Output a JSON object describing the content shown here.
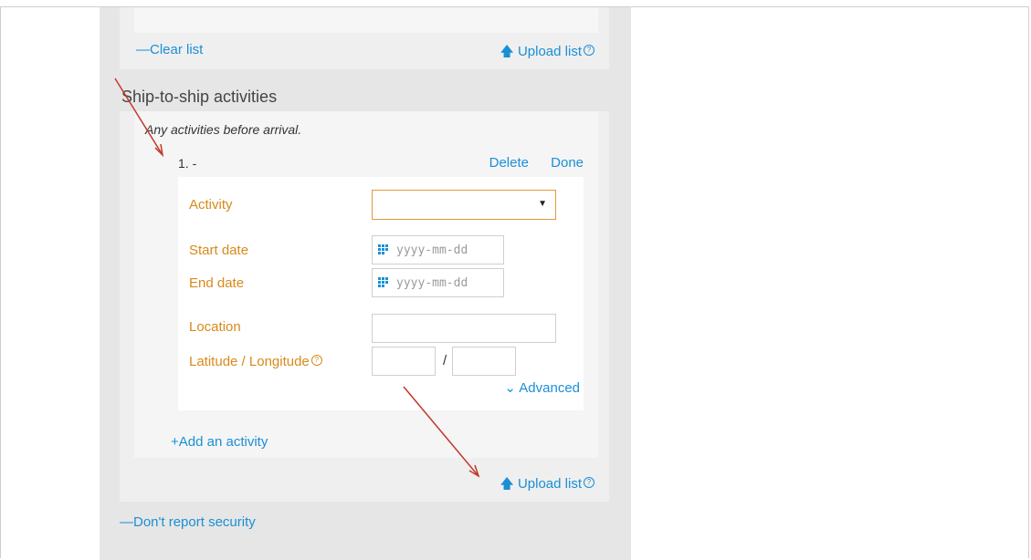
{
  "top_panel": {
    "clear_list": "Clear list",
    "upload_list": "Upload list"
  },
  "section": {
    "title": "Ship-to-ship activities",
    "hint": "Any activities before arrival."
  },
  "item": {
    "number": "1. -",
    "delete": "Delete",
    "done": "Done",
    "fields": {
      "activity_label": "Activity",
      "start_date_label": "Start date",
      "start_date_placeholder": "yyyy-mm-dd",
      "end_date_label": "End date",
      "end_date_placeholder": "yyyy-mm-dd",
      "location_label": "Location",
      "latlon_label": "Latitude / Longitude",
      "latlon_separator": "/"
    },
    "advanced": "Advanced"
  },
  "add_activity": "Add an activity",
  "upload_list_mid": "Upload list",
  "dont_report_security": "Don't report security",
  "colors": {
    "link": "#1a8fd6",
    "label": "#d88a1a",
    "annotation_arrow": "#c0392b"
  }
}
